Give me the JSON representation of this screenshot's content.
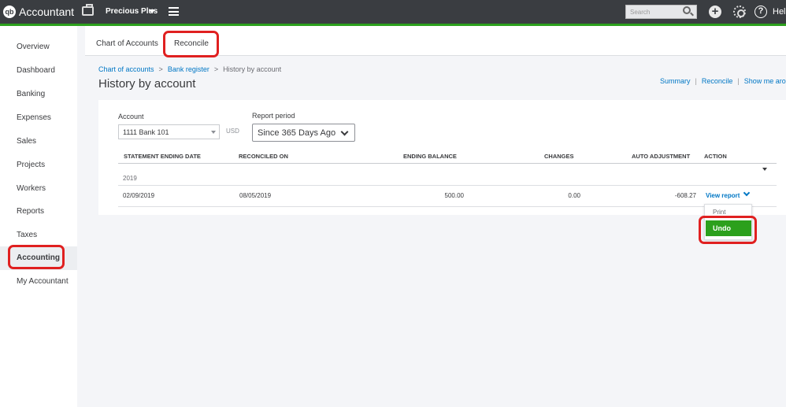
{
  "app": {
    "brand": "Accountant",
    "logo_text": "qb",
    "company_name": "Precious Plus",
    "search_placeholder": "Search",
    "help_label": "Help"
  },
  "sidebar": {
    "items": [
      {
        "label": "Overview"
      },
      {
        "label": "Dashboard"
      },
      {
        "label": "Banking"
      },
      {
        "label": "Expenses"
      },
      {
        "label": "Sales"
      },
      {
        "label": "Projects"
      },
      {
        "label": "Workers"
      },
      {
        "label": "Reports"
      },
      {
        "label": "Taxes"
      },
      {
        "label": "Accounting",
        "active": true
      },
      {
        "label": "My Accountant"
      }
    ]
  },
  "tabs": [
    {
      "label": "Chart of Accounts"
    },
    {
      "label": "Reconcile",
      "active": true
    }
  ],
  "breadcrumb": {
    "items": [
      "Chart of accounts",
      "Bank register",
      "History by account"
    ],
    "separator": ">"
  },
  "page": {
    "title": "History by account",
    "links": [
      "Summary",
      "Reconcile",
      "Show me around"
    ]
  },
  "filters": {
    "account_label": "Account",
    "account_value": "1111 Bank 101",
    "currency": "USD",
    "period_label": "Report period",
    "period_value": "Since 365 Days Ago"
  },
  "table": {
    "columns": [
      "STATEMENT ENDING DATE",
      "RECONCILED ON",
      "ENDING BALANCE",
      "CHANGES",
      "AUTO ADJUSTMENT",
      "ACTION"
    ],
    "group": "2019",
    "rows": [
      {
        "statement_ending_date": "02/09/2019",
        "reconciled_on": "08/05/2019",
        "ending_balance": "500.00",
        "changes": "0.00",
        "auto_adjustment": "-608.27",
        "action": "View report"
      }
    ]
  },
  "action_menu": {
    "items": [
      "Print",
      "Undo"
    ]
  },
  "colors": {
    "topbar": "#3a3d41",
    "accent_green": "#2ca01c",
    "link_blue": "#0077c5",
    "highlight_red": "#e02020"
  }
}
